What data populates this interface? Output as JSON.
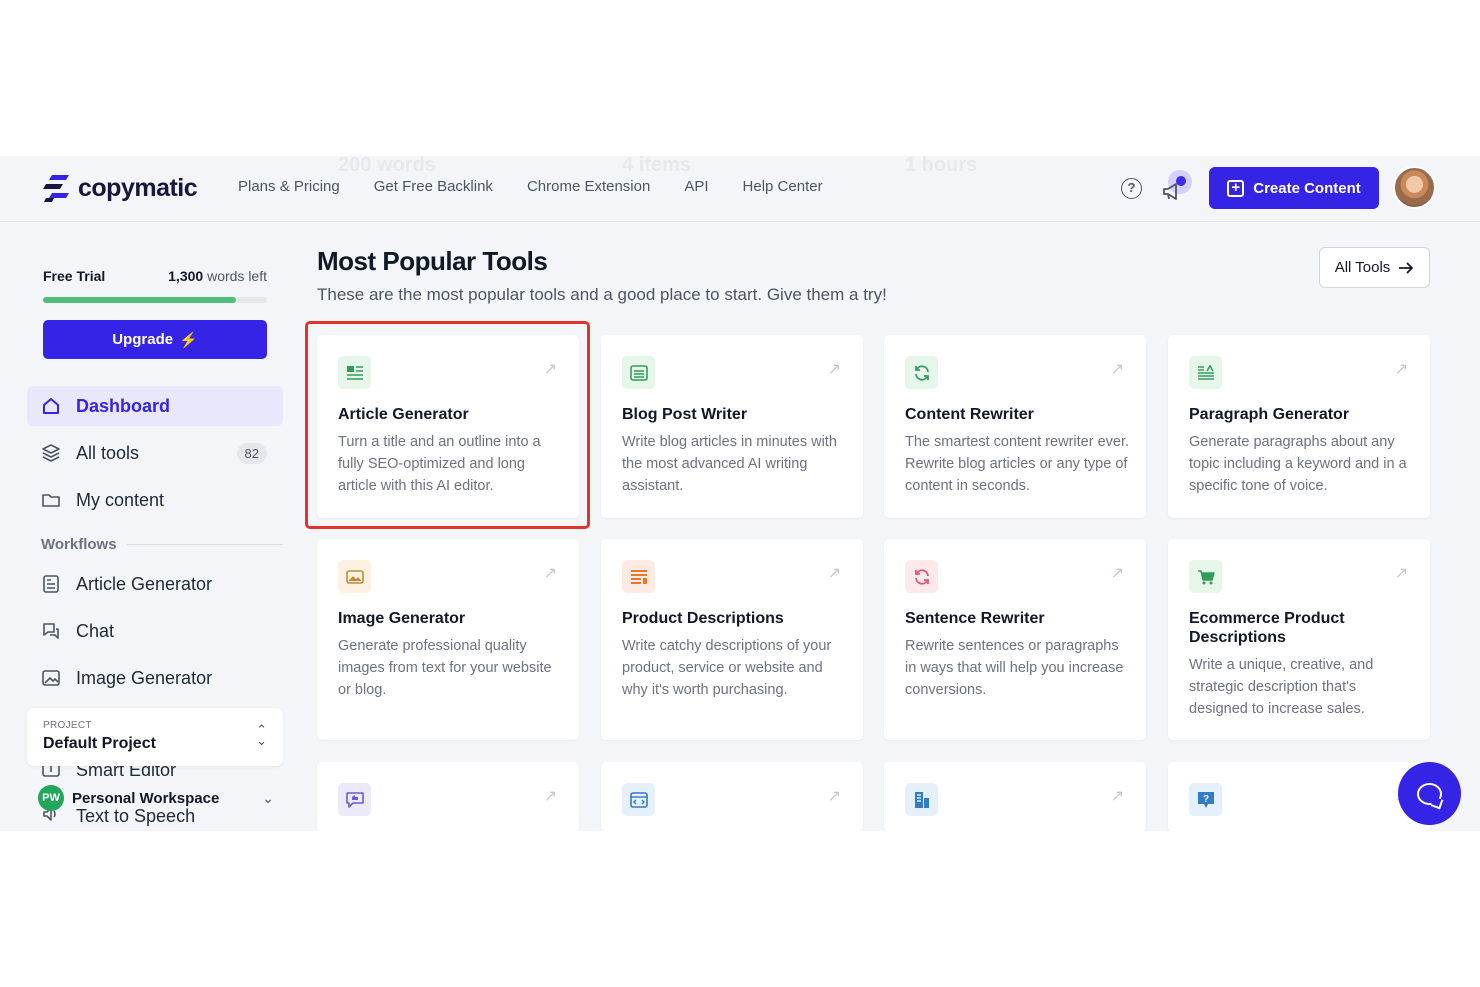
{
  "header": {
    "brand": "copymatic",
    "ghost_stats": [
      "200 words",
      "4 items",
      "1 hours"
    ],
    "nav": [
      "Plans & Pricing",
      "Get Free Backlink",
      "Chrome Extension",
      "API",
      "Help Center"
    ],
    "help_symbol": "?",
    "create_label": "Create Content"
  },
  "sidebar": {
    "plan_label": "Free Trial",
    "words_count": "1,300",
    "words_suffix": "words left",
    "words_progress_fraction": 0.86,
    "upgrade_label": "Upgrade",
    "nav": [
      {
        "label": "Dashboard",
        "icon": "home-icon",
        "active": true
      },
      {
        "label": "All tools",
        "icon": "layers-icon",
        "badge": "82"
      },
      {
        "label": "My content",
        "icon": "folder-icon"
      }
    ],
    "workflows_title": "Workflows",
    "workflows": [
      {
        "label": "Article Generator",
        "icon": "article-icon"
      },
      {
        "label": "Chat",
        "icon": "chat-icon"
      },
      {
        "label": "Image Generator",
        "icon": "image-icon"
      }
    ],
    "project": {
      "small_label": "PROJECT",
      "name": "Default Project"
    },
    "under_items": [
      "Smart Editor",
      "Text to Speech"
    ],
    "workspace": {
      "initials": "PW",
      "name": "Personal Workspace"
    }
  },
  "main": {
    "title": "Most Popular Tools",
    "subtitle": "These are the most popular tools and a good place to start. Give them a try!",
    "all_tools_label": "All Tools",
    "tools": [
      {
        "title": "Article Generator",
        "desc": "Turn a title and an outline into a fully SEO-optimized and long article with this AI editor.",
        "icon": "article-icon",
        "tile_color": "#e6f6ea",
        "icon_color": "#2f9e5a"
      },
      {
        "title": "Blog Post Writer",
        "desc": "Write blog articles in minutes with the most advanced AI writing assistant.",
        "icon": "blog-icon",
        "tile_color": "#e6f6ea",
        "icon_color": "#2f9e5a"
      },
      {
        "title": "Content Rewriter",
        "desc": "The smartest content rewriter ever. Rewrite blog articles or any type of content in seconds.",
        "icon": "refresh-icon",
        "tile_color": "#e6f6ea",
        "icon_color": "#2f9e5a"
      },
      {
        "title": "Paragraph Generator",
        "desc": "Generate paragraphs about any topic including a keyword and in a specific tone of voice.",
        "icon": "paragraph-icon",
        "tile_color": "#e6f6ea",
        "icon_color": "#2f9e5a"
      },
      {
        "title": "Image Generator",
        "desc": "Generate professional quality images from text for your website or blog.",
        "icon": "image-icon",
        "tile_color": "#fdf1e2",
        "icon_color": "#c08a3a"
      },
      {
        "title": "Product Descriptions",
        "desc": "Write catchy descriptions of your product, service or website and why it's worth purchasing.",
        "icon": "list-icon",
        "tile_color": "#fdebe1",
        "icon_color": "#e8772e"
      },
      {
        "title": "Sentence Rewriter",
        "desc": "Rewrite sentences or paragraphs in ways that will help you increase conversions.",
        "icon": "refresh-icon",
        "tile_color": "#fde8ec",
        "icon_color": "#e0566f"
      },
      {
        "title": "Ecommerce Product Descriptions",
        "desc": "Write a unique, creative, and strategic description that's designed to increase sales.",
        "icon": "cart-icon",
        "tile_color": "#e6f6ea",
        "icon_color": "#2f9e5a"
      },
      {
        "title": "",
        "desc": "",
        "icon": "thumbs-up-chat-icon",
        "tile_color": "#ece9fb",
        "icon_color": "#6d5bd0"
      },
      {
        "title": "",
        "desc": "",
        "icon": "code-window-icon",
        "tile_color": "#e5f0fb",
        "icon_color": "#2f7cc9"
      },
      {
        "title": "",
        "desc": "",
        "icon": "building-icon",
        "tile_color": "#e5f0fb",
        "icon_color": "#2f7cc9"
      },
      {
        "title": "",
        "desc": "",
        "icon": "question-icon",
        "tile_color": "#e5f0fb",
        "icon_color": "#2f7cc9"
      }
    ]
  },
  "colors": {
    "brand": "#3524e6",
    "highlight": "#e1352b",
    "progress": "#4fbf7a"
  }
}
